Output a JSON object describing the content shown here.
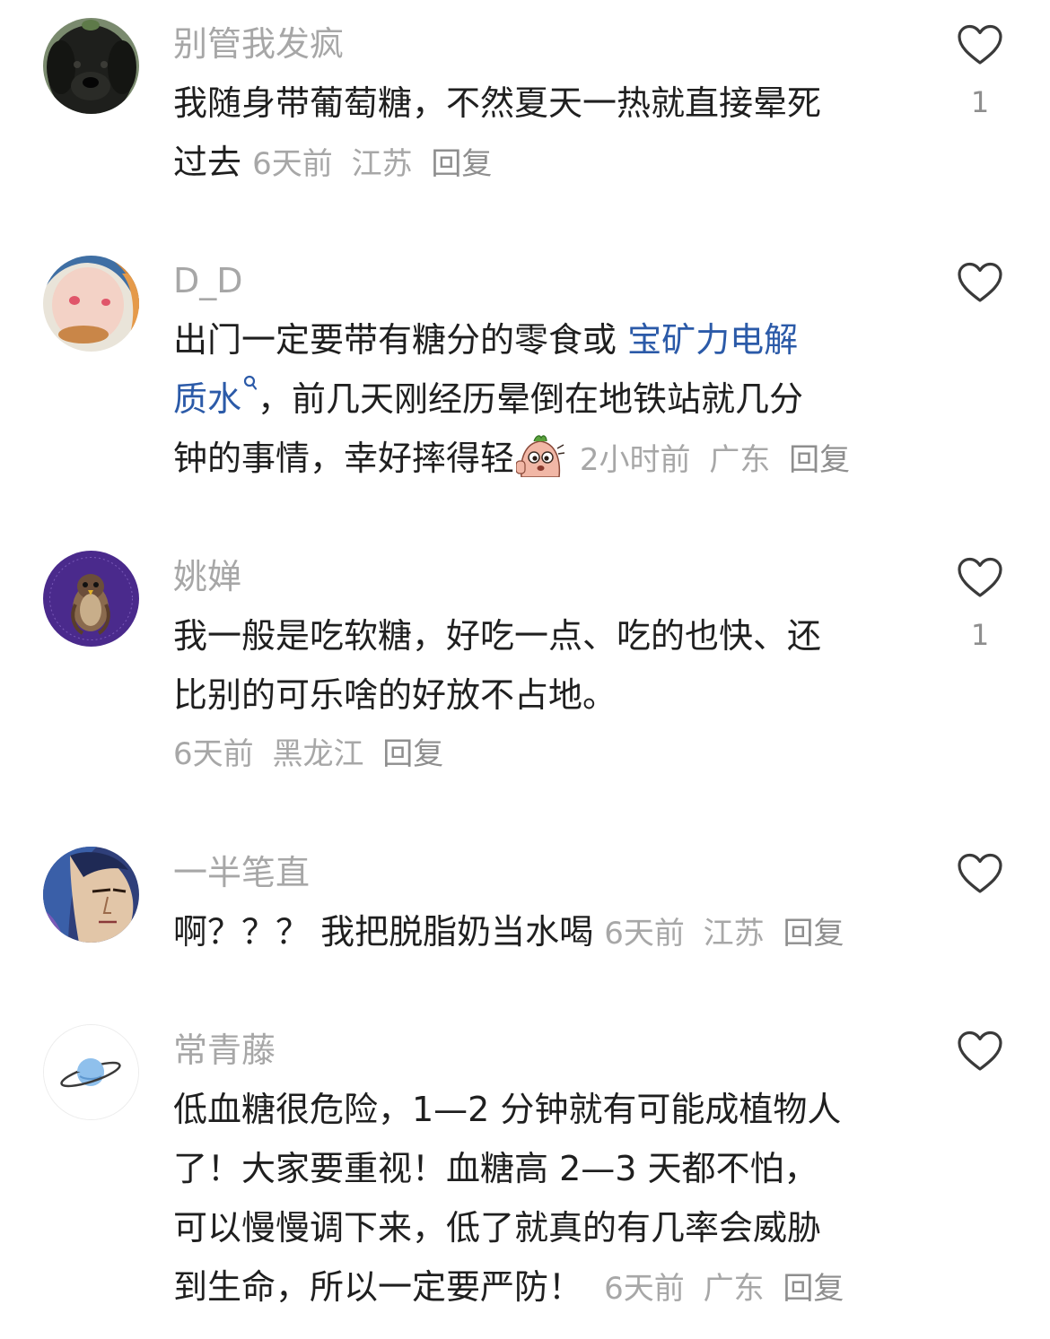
{
  "comments": [
    {
      "user": "别管我发疯",
      "lines": [
        "我随身带葡萄糖，不然夏天一热就直接晕死",
        "过去"
      ],
      "time": "6天前",
      "location": "江苏",
      "reply_label": "回复",
      "likes": "1",
      "avatar_icon": "black-dog-avatar"
    },
    {
      "user": "D_D",
      "line1_prefix": "出门一定要带有糖分的零食或 ",
      "line1_link": "宝矿力电解",
      "line2_link": "质水",
      "line2_rest": "，前几天刚经历晕倒在地铁站就几分",
      "line3": "钟的事情，幸好摔得轻",
      "time": "2小时前",
      "location": "广东",
      "reply_label": "回复",
      "likes": "",
      "avatar_icon": "cartoon-girl-avatar",
      "emoji_icon": "peeking-cartoon-emoji"
    },
    {
      "user": "姚婵",
      "lines": [
        "我一般是吃软糖，好吃一点、吃的也快、还",
        "比别的可乐啥的好放不占地。"
      ],
      "time": "6天前",
      "location": "黑龙江",
      "reply_label": "回复",
      "likes": "1",
      "avatar_icon": "falcon-avatar"
    },
    {
      "user": "一半笔直",
      "lines": [
        "啊？？？ 我把脱脂奶当水喝"
      ],
      "time": "6天前",
      "location": "江苏",
      "reply_label": "回复",
      "likes": "",
      "avatar_icon": "anime-character-avatar"
    },
    {
      "user": "常青藤",
      "lines": [
        "低血糖很危险，1—2 分钟就有可能成植物人",
        "了！大家要重视！血糖高 2—3 天都不怕，",
        "可以慢慢调下来，低了就真的有几率会威胁",
        "到生命，所以一定要严防！"
      ],
      "time": "6天前",
      "location": "广东",
      "reply_label": "回复",
      "likes": "",
      "avatar_icon": "planet-avatar"
    }
  ],
  "colors": {
    "username": "#a7a7a7",
    "text": "#1f1f1f",
    "link": "#2b5aa8",
    "meta": "#a7a7a7",
    "like_stroke": "#3a3a3a"
  },
  "icons": {
    "like": "heart-outline-icon",
    "search": "search-icon"
  }
}
